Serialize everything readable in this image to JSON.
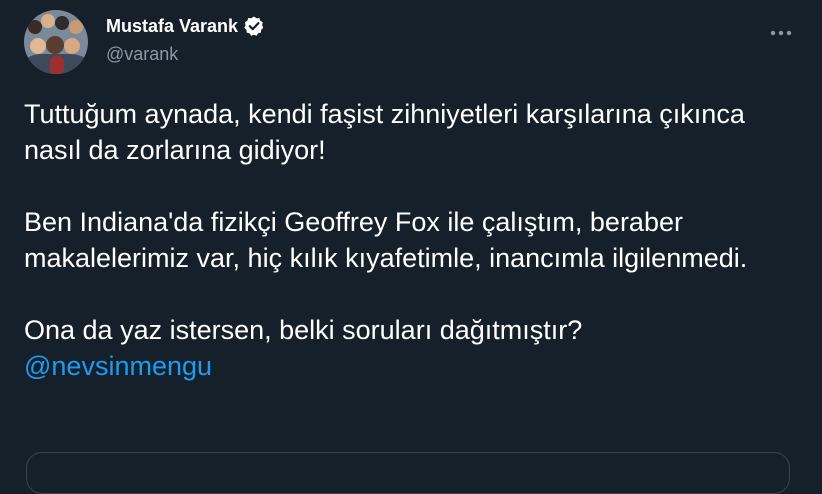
{
  "author": {
    "name": "Mustafa Varank",
    "handle": "@varank",
    "verified_icon": "verified-badge-icon",
    "more_icon": "more-horizontal-icon"
  },
  "tweet": {
    "paragraph1": "Tuttuğum aynada, kendi faşist zihniyetleri karşılarına çıkınca nasıl da zorlarına gidiyor!",
    "paragraph2": "Ben Indiana'da fizikçi Geoffrey Fox ile çalıştım, beraber makalelerimiz var, hiç kılık kıyafetimle, inancımla ilgilenmedi.",
    "paragraph3": "Ona da yaz istersen, belki soruları dağıtmıştır?",
    "mention": "@nevsinmengu"
  },
  "colors": {
    "background": "#15202b",
    "text": "#ffffff",
    "secondary_text": "#8b98a5",
    "link": "#1d9bf0",
    "border": "#38444d"
  }
}
